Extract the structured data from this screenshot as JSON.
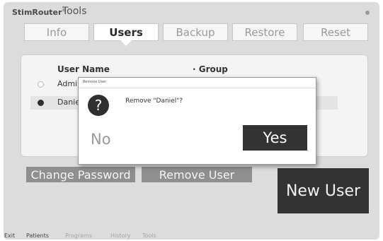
{
  "app": {
    "brand": "StimRouter",
    "brand_mark": "®",
    "title": "Tools"
  },
  "tabs": [
    {
      "label": "Info",
      "active": false
    },
    {
      "label": "Users",
      "active": true
    },
    {
      "label": "Backup",
      "active": false
    },
    {
      "label": "Restore",
      "active": false
    },
    {
      "label": "Reset",
      "active": false
    }
  ],
  "users_table": {
    "columns": [
      "User Name",
      "Group"
    ],
    "rows": [
      {
        "name": "Admi",
        "selected": false
      },
      {
        "name": "Danie",
        "selected": true
      }
    ]
  },
  "actions": {
    "change_password": "Change Password",
    "remove_user": "Remove User",
    "new_user": "New User"
  },
  "dialog": {
    "title": "Remove User",
    "icon": "question-icon",
    "icon_glyph": "?",
    "message": "Remove \"Daniel\"?",
    "no_label": "No",
    "yes_label": "Yes"
  },
  "footer": [
    "Exit",
    "Patients",
    "Programs",
    "History",
    "Tools"
  ],
  "colors": {
    "background": "#dcdcdc",
    "dark_button": "#333333",
    "light_button": "#8f8f8f"
  }
}
